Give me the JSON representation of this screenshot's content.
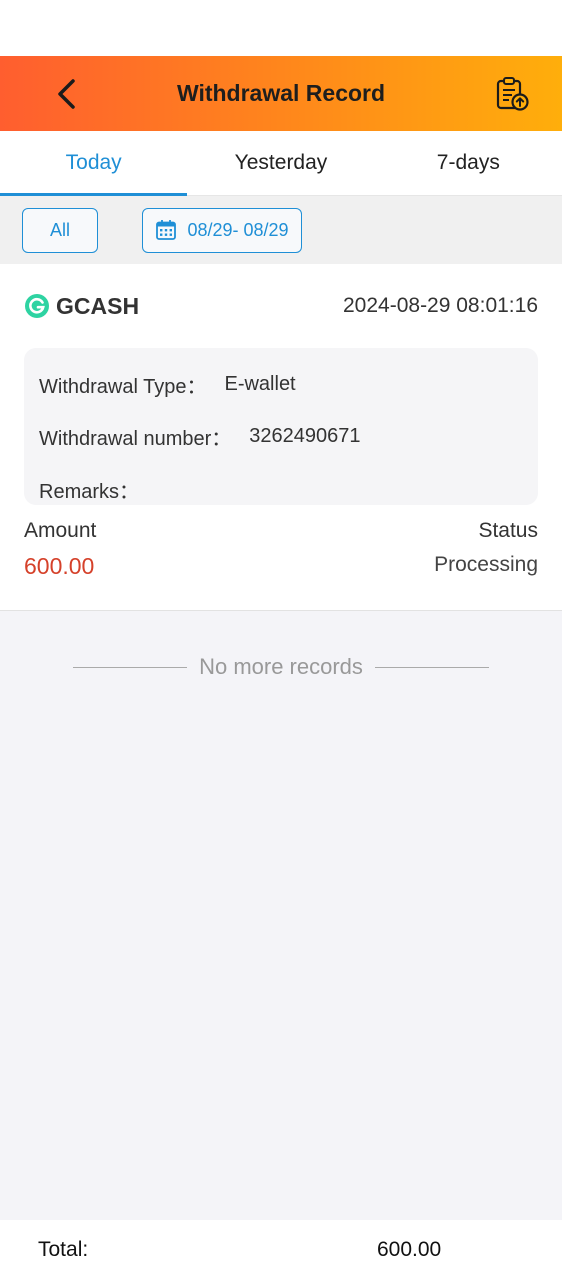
{
  "header": {
    "title": "Withdrawal Record",
    "back_icon": "chevron-left-icon",
    "history_icon": "clipboard-upload-icon"
  },
  "tabs": [
    {
      "label": "Today",
      "active": true
    },
    {
      "label": "Yesterday",
      "active": false
    },
    {
      "label": "7-days",
      "active": false
    }
  ],
  "filters": {
    "all_label": "All",
    "date_range": "08/29- 08/29",
    "date_icon": "calendar-icon"
  },
  "record": {
    "method": "GCASH",
    "datetime": "2024-08-29 08:01:16",
    "type_label": "Withdrawal Type：",
    "type_value": "E-wallet",
    "number_label": "Withdrawal number：",
    "number_value": "3262490671",
    "remarks_label": "Remarks：",
    "remarks_value": "",
    "amount_label": "Amount",
    "amount_value": "600.00",
    "status_label": "Status",
    "status_value": "Processing"
  },
  "list_end": "No more records",
  "footer": {
    "total_label": "Total:",
    "total_value": "600.00"
  },
  "colors": {
    "accent": "#1f8fd6",
    "amount": "#d5412a",
    "gcash": "#2ed3a2"
  }
}
